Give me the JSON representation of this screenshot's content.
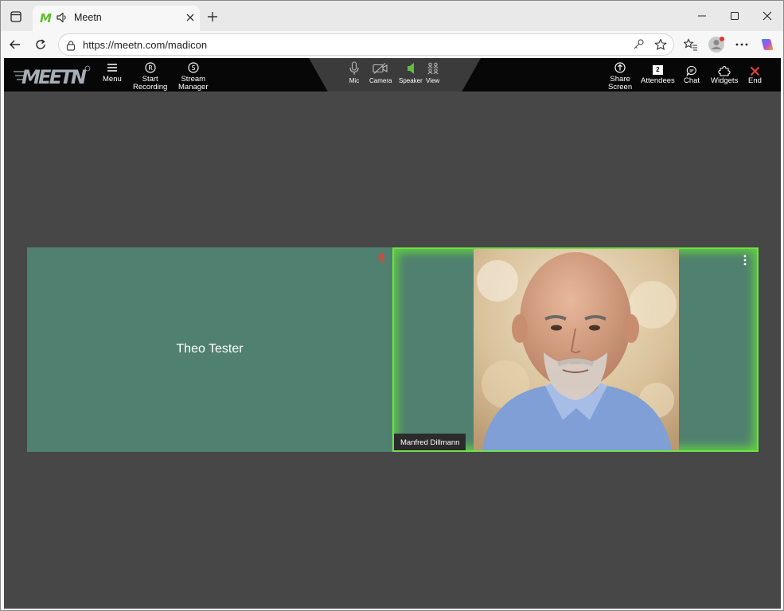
{
  "browser": {
    "tab_title": "Meetn",
    "url": "https://meetn.com/madicon"
  },
  "app": {
    "logo_text": "MEETN",
    "left_nav": [
      {
        "label": "Menu"
      },
      {
        "label": "Start\nRecording"
      },
      {
        "label": "Stream\nManager"
      }
    ],
    "center_nav": [
      {
        "label": "Mic"
      },
      {
        "label": "Camera"
      },
      {
        "label": "Speaker"
      },
      {
        "label": "View"
      }
    ],
    "right_nav": [
      {
        "label": "Share\nScreen"
      },
      {
        "label": "Attendees",
        "count": "2"
      },
      {
        "label": "Chat"
      },
      {
        "label": "Widgets"
      },
      {
        "label": "End"
      }
    ]
  },
  "participants": [
    {
      "name": "Theo Tester",
      "muted": true
    },
    {
      "name": "Manfred Dillmann",
      "speaking": true
    }
  ],
  "colors": {
    "tile_bg": "#508170",
    "speaking_border": "#6ee04a",
    "end_red": "#e8413c",
    "speaker_green": "#5fbf3f"
  }
}
